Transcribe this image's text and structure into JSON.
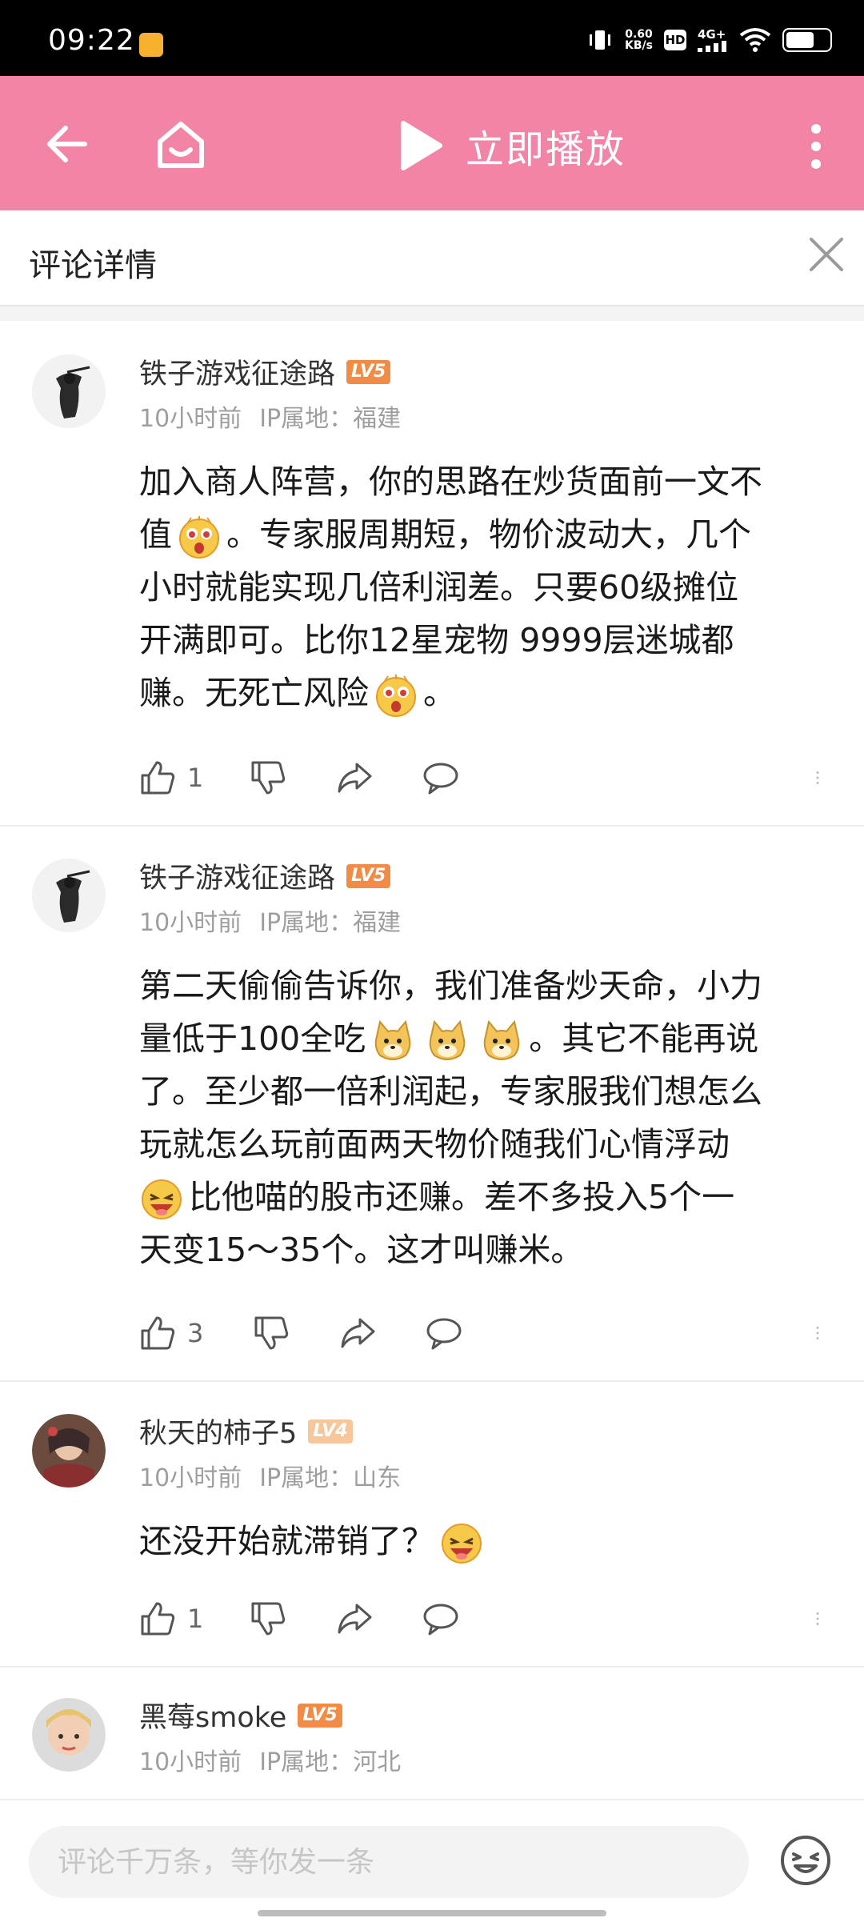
{
  "status_bar": {
    "time": "09:22",
    "net_speed_value": "0.60",
    "net_speed_unit": "KB/s",
    "hd": "HD",
    "network": "4G+"
  },
  "header": {
    "play_label": "立即播放"
  },
  "panel": {
    "title": "评论详情"
  },
  "comments": [
    {
      "username": "铁子游戏征途路",
      "level": "LV5",
      "level_color": "#f28b45",
      "time": "10小时前",
      "ip": "IP属地：福建",
      "content": [
        "加入商人阵营，你的思路在炒货面前一文不",
        "值",
        "。专家服周期短，物价波动大，几个",
        "小时就能实现几倍利润差。只要60级摊位",
        "开满即可。比你12星宠物 9999层迷城都",
        "赚。无死亡风险",
        "。"
      ],
      "likes": "1"
    },
    {
      "username": "铁子游戏征途路",
      "level": "LV5",
      "level_color": "#f28b45",
      "time": "10小时前",
      "ip": "IP属地：福建",
      "content": [
        "第二天偷偷告诉你，我们准备炒天命，小力",
        "量低于100全吃",
        "。其它不能再说",
        "了。至少都一倍利润起，专家服我们想怎么",
        "玩就怎么玩前面两天物价随我们心情浮动",
        "比他喵的股市还赚。差不多投入5个一",
        "天变15～35个。这才叫赚米。"
      ],
      "likes": "3"
    },
    {
      "username": "秋天的柿子5",
      "level": "LV4",
      "level_color": "#f7c79b",
      "time": "10小时前",
      "ip": "IP属地：山东",
      "content": [
        "还没开始就滞销了？"
      ],
      "likes": "1"
    },
    {
      "username": "黑莓smoke",
      "level": "LV5",
      "level_color": "#f28b45",
      "time": "10小时前",
      "ip": "IP属地：河北"
    }
  ],
  "input": {
    "placeholder": "评论千万条，等你发一条"
  },
  "icons": {
    "back": "back-arrow-icon",
    "home": "home-icon",
    "play": "play-icon",
    "more": "more-vertical-icon",
    "close": "close-icon",
    "like": "thumbs-up-icon",
    "dislike": "thumbs-down-icon",
    "share": "share-icon",
    "reply": "comment-bubble-icon",
    "emoji": "emoji-face-icon"
  },
  "colors": {
    "header_bg": "#f284a5",
    "status_bg": "#000000"
  }
}
